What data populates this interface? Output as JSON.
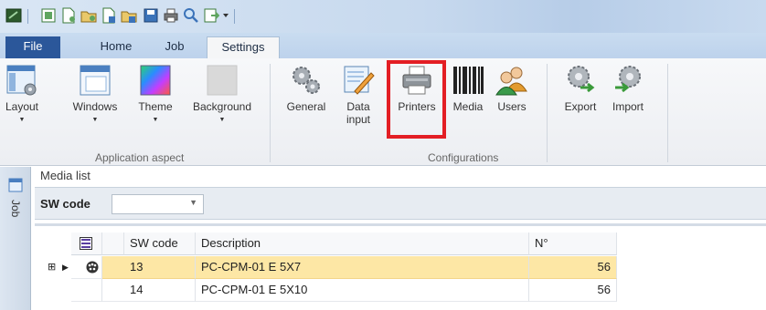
{
  "quick_access": {
    "icons": [
      "app-icon",
      "dropdown-icon",
      "print-preview-icon",
      "new-icon",
      "open-icon",
      "save-as-icon",
      "save-icon",
      "print-icon",
      "search-icon",
      "export-icon",
      "customize-icon"
    ]
  },
  "tabs": [
    {
      "label": "File"
    },
    {
      "label": "Home"
    },
    {
      "label": "Job"
    },
    {
      "label": "Settings"
    }
  ],
  "ribbon": {
    "application_aspect": {
      "label": "Application aspect",
      "buttons": [
        {
          "label": "Layout"
        },
        {
          "label": "Windows"
        },
        {
          "label": "Theme"
        },
        {
          "label": "Background"
        }
      ]
    },
    "configurations": {
      "label": "Configurations",
      "buttons": [
        {
          "label": "General"
        },
        {
          "label": "Data input"
        },
        {
          "label": "Printers"
        },
        {
          "label": "Media"
        },
        {
          "label": "Users"
        },
        {
          "label": "Export"
        },
        {
          "label": "Import"
        }
      ]
    }
  },
  "side_tab": {
    "label": "Job"
  },
  "media_list": {
    "title": "Media list",
    "filter": {
      "label": "SW code",
      "value": ""
    },
    "columns": [
      "SW code",
      "Description",
      "N°"
    ],
    "rows": [
      {
        "sw_code": "13",
        "description": "PC-CPM-01 E 5X7",
        "n": "56",
        "selected": true
      },
      {
        "sw_code": "14",
        "description": "PC-CPM-01 E 5X10",
        "n": "56",
        "selected": false
      }
    ]
  },
  "colors": {
    "file_tab": "#2b579a",
    "selected_row": "#fde7a5",
    "highlight_box": "#e31e24"
  }
}
